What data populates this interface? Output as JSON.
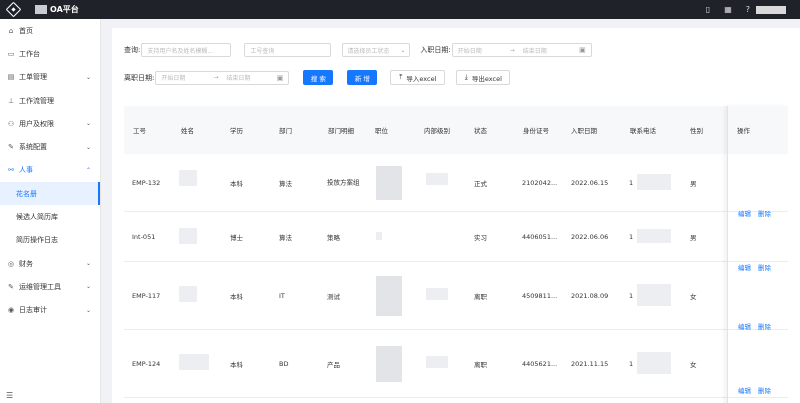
{
  "app": {
    "title": "OA平台",
    "logo_icon": "diamond-logo-icon"
  },
  "topbar": {
    "icons": [
      "mobile-icon",
      "qrcode-icon",
      "help-icon"
    ]
  },
  "sidebar": {
    "items": [
      {
        "label": "首页",
        "icon": "home-icon"
      },
      {
        "label": "工作台",
        "icon": "desktop-icon"
      },
      {
        "label": "工单管理",
        "icon": "ticket-icon",
        "expandable": true
      },
      {
        "label": "工作流管理",
        "icon": "workflow-icon"
      },
      {
        "label": "用户及权限",
        "icon": "user-icon",
        "expandable": true
      },
      {
        "label": "系统配置",
        "icon": "wrench-icon",
        "expandable": true
      },
      {
        "label": "人事",
        "icon": "hr-icon",
        "expandable": true,
        "open": true,
        "children": [
          "花名册",
          "候选人简历库",
          "简历操作日志"
        ]
      },
      {
        "label": "财务",
        "icon": "finance-icon",
        "expandable": true
      },
      {
        "label": "运维管理工具",
        "icon": "tool-icon",
        "expandable": true
      },
      {
        "label": "日志审计",
        "icon": "audit-icon",
        "expandable": true
      }
    ],
    "active_child": "花名册"
  },
  "filters": {
    "query_label": "查询:",
    "query_placeholder": "支持用户名及姓名模糊...",
    "emp_no_placeholder": "工号查询",
    "status_placeholder": "请选择员工状态",
    "join_date_label": "入职日期:",
    "leave_date_label": "离职日期:",
    "start_placeholder": "开始日期",
    "end_placeholder": "结束日期",
    "search_btn": "搜 索",
    "add_btn": "新 增",
    "import_btn": "导入excel",
    "export_btn": "导出excel"
  },
  "table": {
    "columns": [
      "工号",
      "姓名",
      "学历",
      "部门",
      "部门明细",
      "职位",
      "内部级别",
      "状态",
      "身份证号",
      "入职日期",
      "联系电话",
      "性别",
      "操作"
    ],
    "rows": [
      {
        "emp_no": "EMP-132",
        "edu": "本科",
        "dept": "算法",
        "dept_detail": "投放方案组",
        "status": "正式",
        "id_no": "2102042...",
        "join_date": "2022.06.15",
        "phone_prefix": "1",
        "gender": "男"
      },
      {
        "emp_no": "Int-051",
        "edu": "博士",
        "dept": "算法",
        "dept_detail": "策略",
        "status": "实习",
        "id_no": "4406051...",
        "join_date": "2022.06.06",
        "phone_prefix": "1",
        "gender": "男"
      },
      {
        "emp_no": "EMP-117",
        "edu": "本科",
        "dept": "IT",
        "dept_detail": "测试",
        "status": "离职",
        "id_no": "4509811...",
        "join_date": "2021.08.09",
        "phone_prefix": "1",
        "gender": "女"
      },
      {
        "emp_no": "EMP-124",
        "edu": "本科",
        "dept": "BD",
        "dept_detail": "产品",
        "status": "离职",
        "id_no": "4405621...",
        "join_date": "2021.11.15",
        "phone_prefix": "1",
        "gender": "女"
      }
    ],
    "actions": {
      "edit": "编辑",
      "delete": "删除"
    }
  }
}
